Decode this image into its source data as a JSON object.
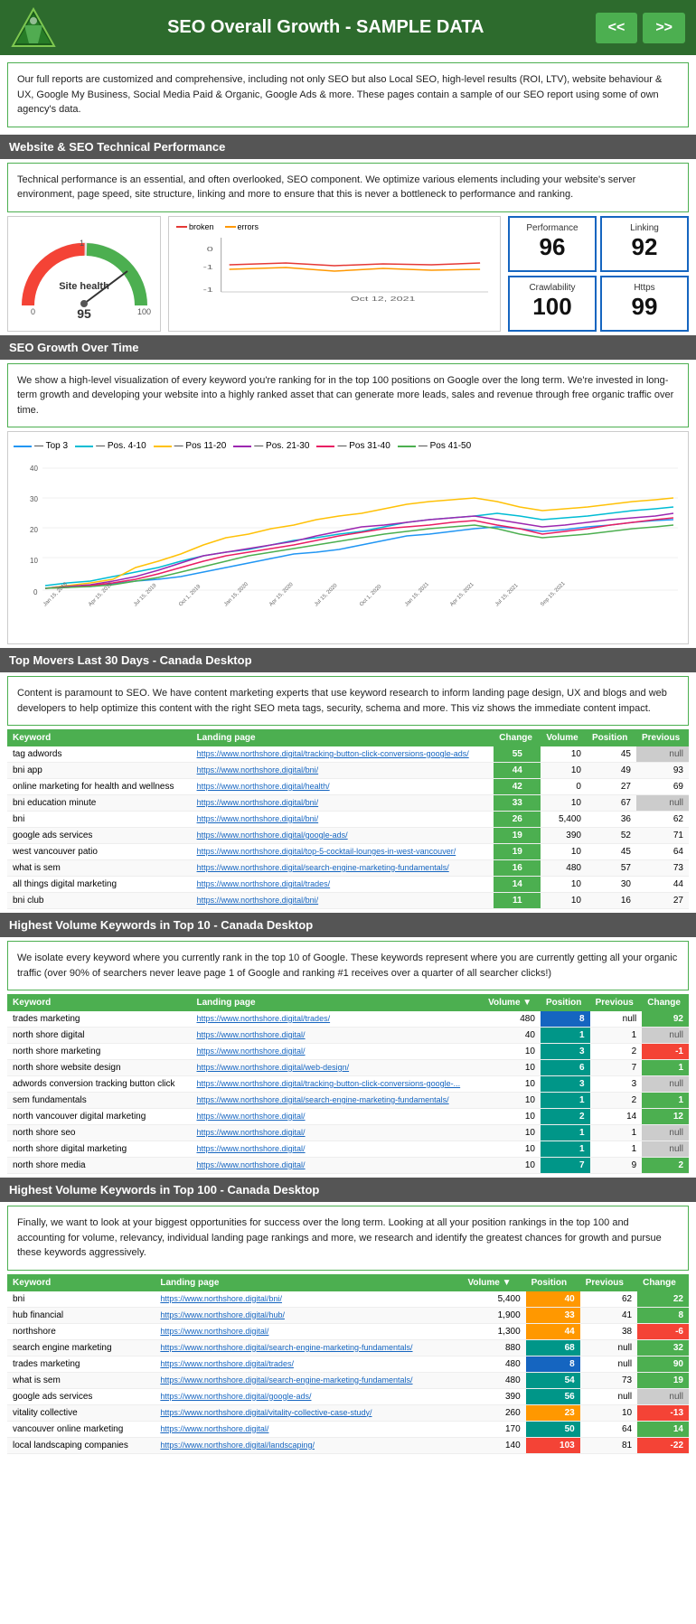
{
  "header": {
    "title": "SEO Overall Growth - SAMPLE DATA",
    "nav_prev": "<<",
    "nav_next": ">>"
  },
  "intro": {
    "text": "Our full reports are customized and comprehensive, including not only SEO but also Local SEO, high-level results (ROI, LTV), website behaviour & UX, Google My Business, Social Media Paid & Organic, Google Ads & more. These pages contain a sample of our SEO report using some of own agency's data."
  },
  "sections": {
    "tech_perf": {
      "header": "Website & SEO Technical Performance",
      "desc": "Technical performance is an essential, and often overlooked, SEO component. We optimize various elements including your website's server environment, page speed, site structure, linking and more to ensure that this is never a bottleneck to performance and ranking.",
      "gauge": {
        "label": "Site health",
        "value": 95,
        "score": 95
      },
      "kpis": [
        {
          "label": "Performance",
          "value": "96"
        },
        {
          "label": "Linking",
          "value": "92"
        },
        {
          "label": "Crawlability",
          "value": "100"
        },
        {
          "label": "Https",
          "value": "99"
        }
      ]
    },
    "growth": {
      "header": "SEO Growth Over Time",
      "desc": "We show a high-level visualization of every keyword you're ranking for in the top 100 positions on Google over the long term. We're invested in long-term growth and developing your website into a highly ranked asset that can generate more leads, sales and revenue through free organic traffic over time.",
      "legend": [
        {
          "label": "Top 3",
          "color": "#2196f3"
        },
        {
          "label": "Pos. 4-10",
          "color": "#00bcd4"
        },
        {
          "label": "Pos 11-20",
          "color": "#ffc107"
        },
        {
          "label": "Pos. 21-30",
          "color": "#9c27b0"
        },
        {
          "label": "Pos 31-40",
          "color": "#e91e63"
        },
        {
          "label": "Pos 41-50",
          "color": "#4caf50"
        }
      ]
    },
    "top_movers": {
      "header": "Top Movers Last 30 Days - Canada Desktop",
      "desc": "Content is paramount to SEO. We have content marketing experts that use keyword research to inform landing page design, UX and blogs and web developers to help optimize this content with the right SEO meta tags, security, schema and more. This viz shows the immediate content impact.",
      "columns": [
        "Keyword",
        "Landing page",
        "Change",
        "Volume",
        "Position",
        "Previous"
      ],
      "rows": [
        {
          "keyword": "tag adwords",
          "url": "https://www.northshore.digital/tracking-button-click-conversions-google-ads/",
          "change": 55,
          "volume": 10,
          "position": 45,
          "previous": "null",
          "change_type": "green"
        },
        {
          "keyword": "bni app",
          "url": "https://www.northshore.digital/bni/",
          "change": 44,
          "volume": 10,
          "position": 49,
          "previous": 93,
          "change_type": "green"
        },
        {
          "keyword": "online marketing for health and wellness",
          "url": "https://www.northshore.digital/health/",
          "change": 42,
          "volume": 0,
          "position": 27,
          "previous": 69,
          "change_type": "green"
        },
        {
          "keyword": "bni education minute",
          "url": "https://www.northshore.digital/bni/",
          "change": 33,
          "volume": 10,
          "position": 67,
          "previous": "null",
          "change_type": "green"
        },
        {
          "keyword": "bni",
          "url": "https://www.northshore.digital/bni/",
          "change": 26,
          "volume": "5,400",
          "position": 36,
          "previous": 62,
          "change_type": "green"
        },
        {
          "keyword": "google ads services",
          "url": "https://www.northshore.digital/google-ads/",
          "change": 19,
          "volume": 390,
          "position": 52,
          "previous": 71,
          "change_type": "green"
        },
        {
          "keyword": "west vancouver patio",
          "url": "https://www.northshore.digital/top-5-cocktail-lounges-in-west-vancouver/",
          "change": 19,
          "volume": 10,
          "position": 45,
          "previous": 64,
          "change_type": "green"
        },
        {
          "keyword": "what is sem",
          "url": "https://www.northshore.digital/search-engine-marketing-fundamentals/",
          "change": 16,
          "volume": 480,
          "position": 57,
          "previous": 73,
          "change_type": "green"
        },
        {
          "keyword": "all things digital marketing",
          "url": "https://www.northshore.digital/trades/",
          "change": 14,
          "volume": 10,
          "position": 30,
          "previous": 44,
          "change_type": "green"
        },
        {
          "keyword": "bni club",
          "url": "https://www.northshore.digital/bni/",
          "change": 11,
          "volume": 10,
          "position": 16,
          "previous": 27,
          "change_type": "green"
        }
      ]
    },
    "top10": {
      "header": "Highest Volume Keywords in Top 10 - Canada Desktop",
      "desc": "We isolate every keyword where you currently rank in the top 10 of Google. These keywords represent where you are currently getting all your organic traffic (over 90% of searchers never leave page 1 of Google and ranking #1 receives over a quarter of all searcher clicks!)",
      "columns": [
        "Keyword",
        "Landing page",
        "Volume ▼",
        "Position",
        "Previous",
        "Change"
      ],
      "rows": [
        {
          "keyword": "trades marketing",
          "url": "https://www.northshore.digital/trades/",
          "volume": 480,
          "position": 8,
          "previous": "null",
          "change": 92,
          "pos_type": "blue"
        },
        {
          "keyword": "north shore digital",
          "url": "https://www.northshore.digital/",
          "volume": 40,
          "position": 1,
          "previous": 1,
          "change": "null",
          "pos_type": "green"
        },
        {
          "keyword": "north shore marketing",
          "url": "https://www.northshore.digital/",
          "volume": 10,
          "position": 3,
          "previous": 2,
          "change": -1,
          "pos_type": "green"
        },
        {
          "keyword": "north shore website design",
          "url": "https://www.northshore.digital/web-design/",
          "volume": 10,
          "position": 6,
          "previous": 7,
          "change": 1,
          "pos_type": "green"
        },
        {
          "keyword": "adwords conversion tracking button click",
          "url": "https://www.northshore.digital/tracking-button-click-conversions-google-...",
          "volume": 10,
          "position": 3,
          "previous": 3,
          "change": "null",
          "pos_type": "green"
        },
        {
          "keyword": "sem fundamentals",
          "url": "https://www.northshore.digital/search-engine-marketing-fundamentals/",
          "volume": 10,
          "position": 1,
          "previous": 2,
          "change": 1,
          "pos_type": "green"
        },
        {
          "keyword": "north vancouver digital marketing",
          "url": "https://www.northshore.digital/",
          "volume": 10,
          "position": 2,
          "previous": 14,
          "change": 12,
          "pos_type": "green"
        },
        {
          "keyword": "north shore seo",
          "url": "https://www.northshore.digital/",
          "volume": 10,
          "position": 1,
          "previous": 1,
          "change": "null",
          "pos_type": "green"
        },
        {
          "keyword": "north shore digital marketing",
          "url": "https://www.northshore.digital/",
          "volume": 10,
          "position": 1,
          "previous": 1,
          "change": "null",
          "pos_type": "green"
        },
        {
          "keyword": "north shore media",
          "url": "https://www.northshore.digital/",
          "volume": 10,
          "position": 7,
          "previous": 9,
          "change": 2,
          "pos_type": "teal"
        }
      ]
    },
    "top100": {
      "header": "Highest Volume Keywords in Top 100 - Canada Desktop",
      "desc": "Finally, we want to look at your biggest opportunities for success over the long term. Looking at all your position rankings in the top 100 and accounting for volume, relevancy, individual landing page rankings and more, we research and identify the greatest chances for growth and pursue these keywords aggressively.",
      "columns": [
        "Keyword",
        "Landing page",
        "Volume ▼",
        "Position",
        "Previous",
        "Change"
      ],
      "rows": [
        {
          "keyword": "bni",
          "url": "https://www.northshore.digital/bni/",
          "volume": "5,400",
          "position": 40,
          "previous": 62,
          "change": 22,
          "pos_type": "orange"
        },
        {
          "keyword": "hub financial",
          "url": "https://www.northshore.digital/hub/",
          "volume": "1,900",
          "position": 33,
          "previous": 41,
          "change": 8,
          "pos_type": "orange"
        },
        {
          "keyword": "northshore",
          "url": "https://www.northshore.digital/",
          "volume": "1,300",
          "position": 44,
          "previous": 38,
          "change": -6,
          "pos_type": "orange"
        },
        {
          "keyword": "search engine marketing",
          "url": "https://www.northshore.digital/search-engine-marketing-fundamentals/",
          "volume": 880,
          "position": 68,
          "previous": "null",
          "change": 32,
          "pos_type": "teal"
        },
        {
          "keyword": "trades marketing",
          "url": "https://www.northshore.digital/trades/",
          "volume": 480,
          "position": 8,
          "previous": "null",
          "change": 90,
          "pos_type": "blue"
        },
        {
          "keyword": "what is sem",
          "url": "https://www.northshore.digital/search-engine-marketing-fundamentals/",
          "volume": 480,
          "position": 54,
          "previous": 73,
          "change": 19,
          "pos_type": "teal"
        },
        {
          "keyword": "google ads services",
          "url": "https://www.northshore.digital/google-ads/",
          "volume": 390,
          "position": 56,
          "previous": "null",
          "change": "null",
          "pos_type": "teal"
        },
        {
          "keyword": "vitality collective",
          "url": "https://www.northshore.digital/vitality-collective-case-study/",
          "volume": 260,
          "position": 23,
          "previous": 10,
          "change": -13,
          "pos_type": "orange"
        },
        {
          "keyword": "vancouver online marketing",
          "url": "https://www.northshore.digital/",
          "volume": 170,
          "position": 50,
          "previous": 64,
          "change": 14,
          "pos_type": "teal"
        },
        {
          "keyword": "local landscaping companies",
          "url": "https://www.northshore.digital/landscaping/",
          "volume": 140,
          "position": 103,
          "previous": 81,
          "change": -22,
          "pos_type": "red"
        }
      ]
    }
  }
}
